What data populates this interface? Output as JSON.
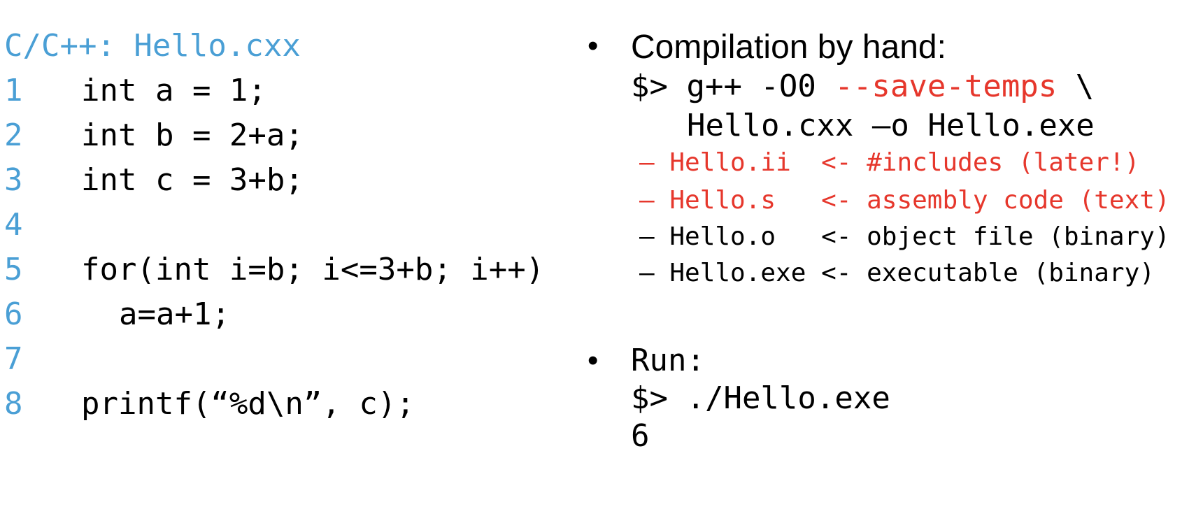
{
  "colors": {
    "line_number": "#4a9fd5",
    "highlight": "#e6372c",
    "text": "#000000",
    "background": "#ffffff"
  },
  "code": {
    "title": "C/C++: Hello.cxx",
    "lines": [
      {
        "no": "1",
        "text": "int a = 1;"
      },
      {
        "no": "2",
        "text": "int b = 2+a;"
      },
      {
        "no": "3",
        "text": "int c = 3+b;"
      },
      {
        "no": "4",
        "text": ""
      },
      {
        "no": "5",
        "text": "for(int i=b; i<=3+b; i++)"
      },
      {
        "no": "6",
        "text": "a=a+1;"
      },
      {
        "no": "7",
        "text": ""
      },
      {
        "no": "8",
        "text": "printf(“%d\\n”, c);"
      }
    ]
  },
  "compile": {
    "bullet": "•",
    "heading": "Compilation by hand:",
    "cmd_prompt": "$> g++ -O0 ",
    "cmd_flag": "--save-temps",
    "cmd_cont": " \\",
    "cmd_line2": "Hello.cxx –o Hello.exe",
    "outputs": [
      {
        "text": "– Hello.ii  <- #includes (later!)",
        "highlight": true
      },
      {
        "text": "– Hello.s   <- assembly code (text)",
        "highlight": true
      },
      {
        "text": "– Hello.o   <- object file (binary)",
        "highlight": false
      },
      {
        "text": "– Hello.exe <- executable (binary)",
        "highlight": false
      }
    ]
  },
  "run": {
    "bullet": "•",
    "heading": "Run:",
    "cmd": "$> ./Hello.exe",
    "output": "6"
  }
}
